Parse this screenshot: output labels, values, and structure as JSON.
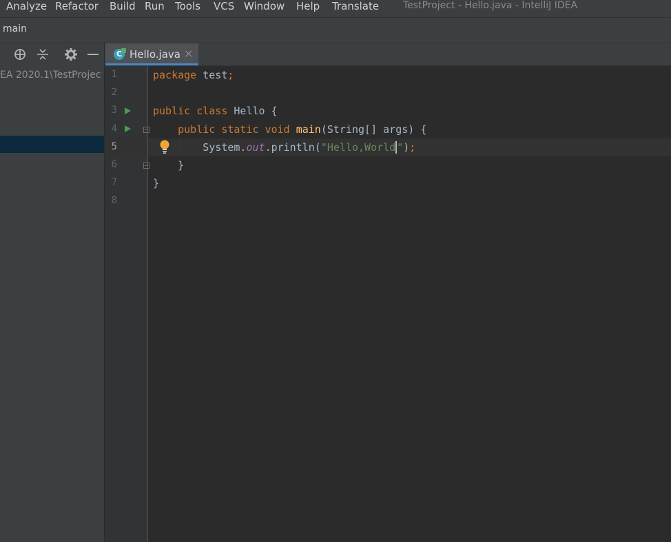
{
  "menu": {
    "items": [
      "Analyze",
      "Refactor",
      "Build",
      "Run",
      "Tools",
      "VCS",
      "Window",
      "Help",
      "Translate"
    ],
    "window_title": "TestProject - Hello.java - IntelliJ IDEA"
  },
  "navbar": {
    "crumb": "main"
  },
  "project_panel": {
    "path_text": "EA 2020.1\\TestProjec",
    "toolbar_icons": [
      "locate-icon",
      "collapse-icon",
      "gear-icon",
      "minimize-icon"
    ]
  },
  "tabs": [
    {
      "label": "Hello.java",
      "icon": "C",
      "close": "×"
    }
  ],
  "editor": {
    "line_numbers": [
      "1",
      "2",
      "3",
      "4",
      "5",
      "6",
      "7",
      "8"
    ],
    "current_line": 5,
    "lines": [
      [
        {
          "t": "package ",
          "c": "kw"
        },
        {
          "t": "test",
          "c": "pl"
        },
        {
          "t": ";",
          "c": "kw"
        }
      ],
      [],
      [
        {
          "t": "public ",
          "c": "kw"
        },
        {
          "t": "class ",
          "c": "kw"
        },
        {
          "t": "Hello {",
          "c": "pl"
        }
      ],
      [
        {
          "t": "    public ",
          "c": "kw"
        },
        {
          "t": "static ",
          "c": "kw"
        },
        {
          "t": "void ",
          "c": "kw"
        },
        {
          "t": "main",
          "c": "fn"
        },
        {
          "t": "(String[] args) {",
          "c": "pl"
        }
      ],
      [
        {
          "t": "        System.",
          "c": "pl"
        },
        {
          "t": "out",
          "c": "it"
        },
        {
          "t": ".println(",
          "c": "pl"
        },
        {
          "t": "\"Hello,World",
          "c": "st"
        },
        {
          "t": "CARET",
          "c": "caret"
        },
        {
          "t": "\"",
          "c": "st"
        },
        {
          "t": ")",
          "c": "pl"
        },
        {
          "t": ";",
          "c": "kw"
        }
      ],
      [
        {
          "t": "    }",
          "c": "pl"
        }
      ],
      [
        {
          "t": "}",
          "c": "pl"
        }
      ],
      []
    ]
  },
  "colors": {
    "accent": "#4a88c7",
    "keyword": "#cc7832",
    "string": "#6a8759",
    "function": "#ffc66d",
    "run": "#499c54"
  }
}
